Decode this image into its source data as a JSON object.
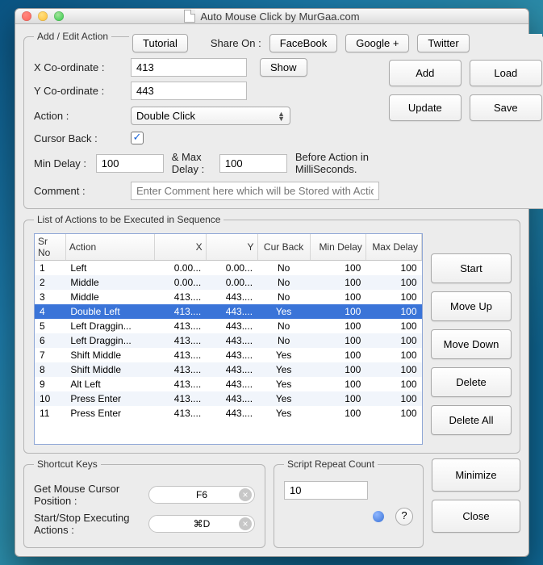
{
  "window": {
    "title": "Auto Mouse Click by MurGaa.com"
  },
  "top": {
    "tutorial": "Tutorial",
    "share_label": "Share On :",
    "facebook": "FaceBook",
    "googleplus": "Google +",
    "twitter": "Twitter"
  },
  "addedit": {
    "legend": "Add / Edit Action",
    "x_label": "X Co-ordinate :",
    "y_label": "Y Co-ordinate :",
    "x_value": "413",
    "y_value": "443",
    "show": "Show",
    "action_label": "Action :",
    "action_value": "Double Click",
    "cursor_back_label": "Cursor Back :",
    "cursor_back_checked": "✓",
    "min_delay_label": "Min Delay :",
    "min_delay_value": "100",
    "mid_text": "& Max Delay :",
    "max_delay_value": "100",
    "after_text": "Before Action in MilliSeconds.",
    "comment_label": "Comment :",
    "comment_placeholder": "Enter Comment here which will be Stored with Action",
    "add": "Add",
    "load": "Load",
    "update": "Update",
    "save": "Save"
  },
  "actions": {
    "legend": "List of Actions to be Executed in Sequence",
    "start": "Start",
    "moveup": "Move Up",
    "movedown": "Move Down",
    "delete": "Delete",
    "deleteall": "Delete All",
    "headers": {
      "sr": "Sr No",
      "action": "Action",
      "x": "X",
      "y": "Y",
      "cb": "Cur Back",
      "min": "Min Delay",
      "max": "Max Delay"
    },
    "rows": [
      {
        "sr": "1",
        "action": "Left",
        "x": "0.00...",
        "y": "0.00...",
        "cb": "No",
        "min": "100",
        "max": "100",
        "sel": false
      },
      {
        "sr": "2",
        "action": "Middle",
        "x": "0.00...",
        "y": "0.00...",
        "cb": "No",
        "min": "100",
        "max": "100",
        "sel": false
      },
      {
        "sr": "3",
        "action": "Middle",
        "x": "413....",
        "y": "443....",
        "cb": "No",
        "min": "100",
        "max": "100",
        "sel": false
      },
      {
        "sr": "4",
        "action": "Double Left",
        "x": "413....",
        "y": "443....",
        "cb": "Yes",
        "min": "100",
        "max": "100",
        "sel": true
      },
      {
        "sr": "5",
        "action": "Left Draggin...",
        "x": "413....",
        "y": "443....",
        "cb": "No",
        "min": "100",
        "max": "100",
        "sel": false
      },
      {
        "sr": "6",
        "action": "Left Draggin...",
        "x": "413....",
        "y": "443....",
        "cb": "No",
        "min": "100",
        "max": "100",
        "sel": false
      },
      {
        "sr": "7",
        "action": "Shift Middle",
        "x": "413....",
        "y": "443....",
        "cb": "Yes",
        "min": "100",
        "max": "100",
        "sel": false
      },
      {
        "sr": "8",
        "action": "Shift Middle",
        "x": "413....",
        "y": "443....",
        "cb": "Yes",
        "min": "100",
        "max": "100",
        "sel": false
      },
      {
        "sr": "9",
        "action": "Alt Left",
        "x": "413....",
        "y": "443....",
        "cb": "Yes",
        "min": "100",
        "max": "100",
        "sel": false
      },
      {
        "sr": "10",
        "action": "Press Enter",
        "x": "413....",
        "y": "443....",
        "cb": "Yes",
        "min": "100",
        "max": "100",
        "sel": false
      },
      {
        "sr": "11",
        "action": "Press Enter",
        "x": "413....",
        "y": "443....",
        "cb": "Yes",
        "min": "100",
        "max": "100",
        "sel": false
      }
    ]
  },
  "shortcuts": {
    "legend": "Shortcut Keys",
    "get_pos_label": "Get Mouse Cursor Position :",
    "get_pos_key": "F6",
    "startstop_label": "Start/Stop Executing Actions :",
    "startstop_key": "⌘D"
  },
  "repeat": {
    "legend": "Script Repeat Count",
    "value": "10"
  },
  "bottom": {
    "minimize": "Minimize",
    "close": "Close",
    "help": "?"
  }
}
